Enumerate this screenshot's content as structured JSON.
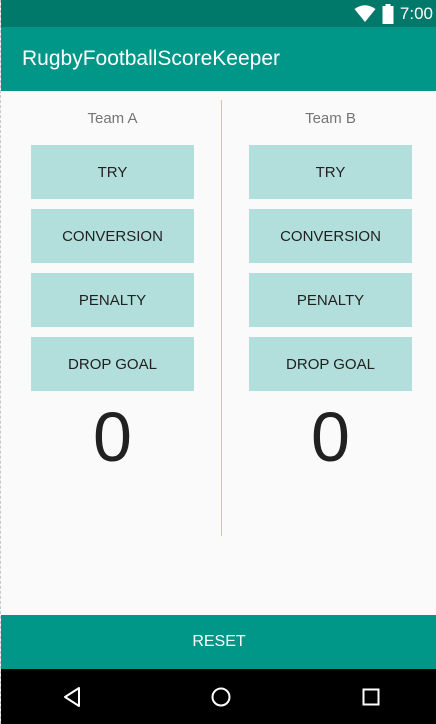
{
  "status_bar": {
    "time": "7:00",
    "icons": [
      "wifi-icon",
      "battery-icon"
    ]
  },
  "app_bar": {
    "title": "RugbyFootballScoreKeeper"
  },
  "team_a": {
    "name": "Team A",
    "buttons": {
      "try": "TRY",
      "conversion": "CONVERSION",
      "penalty": "PENALTY",
      "drop_goal": "DROP GOAL"
    },
    "score": "0"
  },
  "team_b": {
    "name": "Team B",
    "buttons": {
      "try": "TRY",
      "conversion": "CONVERSION",
      "penalty": "PENALTY",
      "drop_goal": "DROP GOAL"
    },
    "score": "0"
  },
  "reset_label": "RESET",
  "nav_bar": {
    "icons": [
      "back-icon",
      "home-icon",
      "recent-apps-icon"
    ]
  },
  "colors": {
    "status_bar": "#00796b",
    "primary": "#009688",
    "button": "#b2dfdb",
    "divider": "#cddc39",
    "background": "#fafafa"
  }
}
